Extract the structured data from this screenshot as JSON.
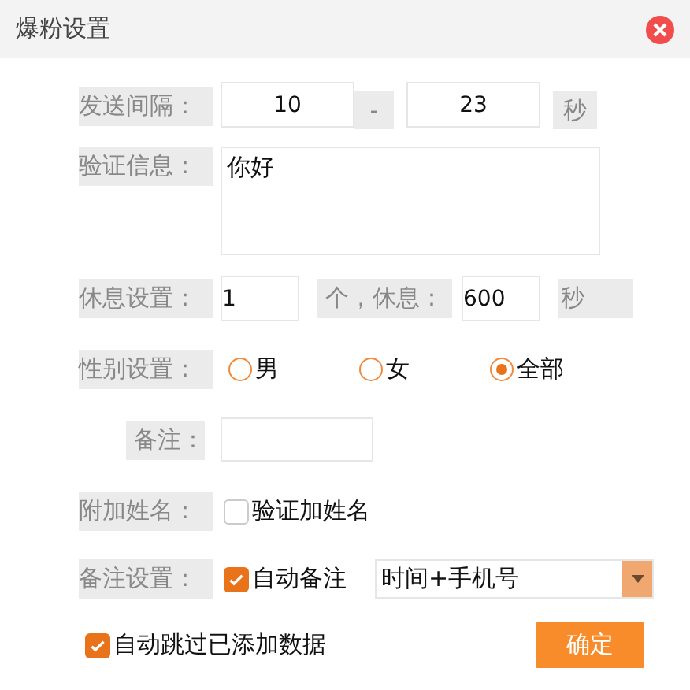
{
  "window": {
    "title": "爆粉设置"
  },
  "send_interval": {
    "label": "发送间隔：",
    "from": "10",
    "separator": "-",
    "to": "23",
    "unit": "秒"
  },
  "verify_message": {
    "label": "验证信息：",
    "value": "你好"
  },
  "rest": {
    "label": "休息设置：",
    "count": "1",
    "middle": "个，休息：",
    "seconds": "600",
    "unit": "秒"
  },
  "gender": {
    "label": "性别设置：",
    "options": [
      {
        "label": "男",
        "selected": false
      },
      {
        "label": "女",
        "selected": false
      },
      {
        "label": "全部",
        "selected": true
      }
    ]
  },
  "note": {
    "label": "备注："
  },
  "append_name": {
    "label": "附加姓名：",
    "checkbox": {
      "label": "验证加姓名",
      "checked": false
    }
  },
  "remark": {
    "label": "备注设置：",
    "checkbox": {
      "label": "自动备注",
      "checked": true
    },
    "dropdown": {
      "value": "时间+手机号"
    }
  },
  "skip_added": {
    "label": "自动跳过已添加数据",
    "checked": true
  },
  "confirm_button": "确定"
}
